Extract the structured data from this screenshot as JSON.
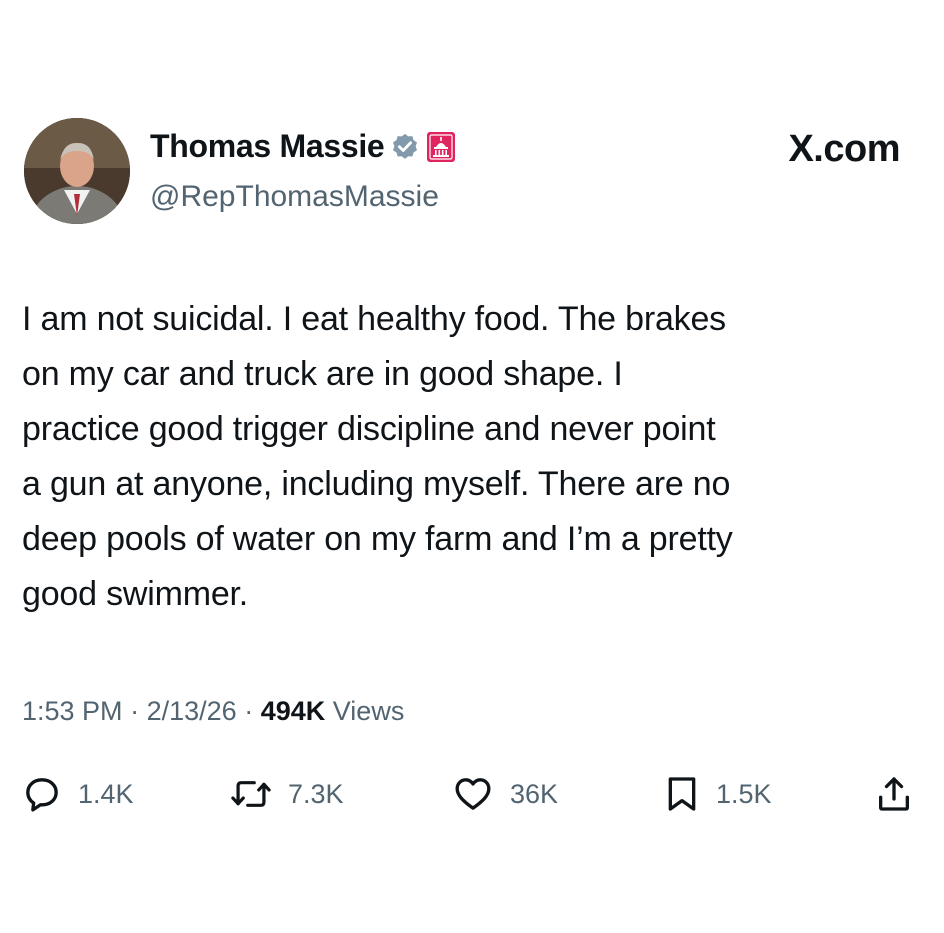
{
  "author": {
    "display_name": "Thomas Massie",
    "handle": "@RepThomasMassie",
    "verified_icon": "verified-badge-icon",
    "affiliation_icon": "capitol-badge-icon",
    "affiliation_color": "#e0245e",
    "verified_color": "#829aab"
  },
  "site_label": "X.com",
  "tweet": {
    "lines": [
      "I am not suicidal. I eat healthy food. The brakes",
      "on my car and truck are in good shape. I",
      "practice good trigger discipline and never point",
      "a gun at anyone,  including myself. There are no",
      "deep pools of water on my farm and I’m a pretty",
      "good swimmer."
    ]
  },
  "meta": {
    "time": "1:53 PM",
    "date": "2/13/26",
    "separator": "·",
    "views_count": "494K",
    "views_label": "Views"
  },
  "actions": {
    "replies": "1.4K",
    "reposts": "7.3K",
    "likes": "36K",
    "bookmarks": "1.5K"
  }
}
